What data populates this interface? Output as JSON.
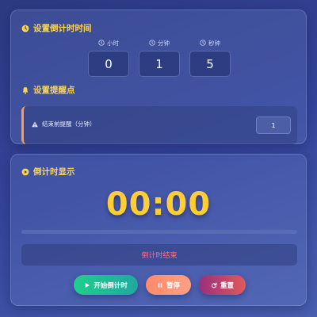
{
  "colors": {
    "accent_yellow": "#ffd54a",
    "countdown_yellow": "#ffcd35",
    "status_red": "#ff6b8a",
    "reminder_border": "#ff9a4a",
    "start_green": "#1fcf8c",
    "pause_salmon": "#ff8a6a",
    "reset_magenta": "#9a2f7d"
  },
  "settings": {
    "title": "设置倒计时时间",
    "title_icon": "clock-icon",
    "fields": [
      {
        "label": "小时",
        "icon": "clock-icon",
        "value": "0"
      },
      {
        "label": "分钟",
        "icon": "clock-icon",
        "value": "1"
      },
      {
        "label": "秒钟",
        "icon": "clock-icon",
        "value": "5"
      }
    ]
  },
  "reminder": {
    "title": "设置提醒点",
    "title_icon": "bell-icon",
    "label": "结束前提醒（分钟）",
    "label_icon": "warning-icon",
    "value": "1"
  },
  "display": {
    "title": "倒计时显示",
    "title_icon": "play-circle-icon",
    "countdown": "00:00",
    "progress_percent": 0,
    "status": "倒计时结束"
  },
  "buttons": {
    "start": {
      "label": "开始倒计时",
      "icon": "play-icon"
    },
    "pause": {
      "label": "暂停",
      "icon": "pause-icon"
    },
    "reset": {
      "label": "重置",
      "icon": "redo-icon"
    }
  }
}
